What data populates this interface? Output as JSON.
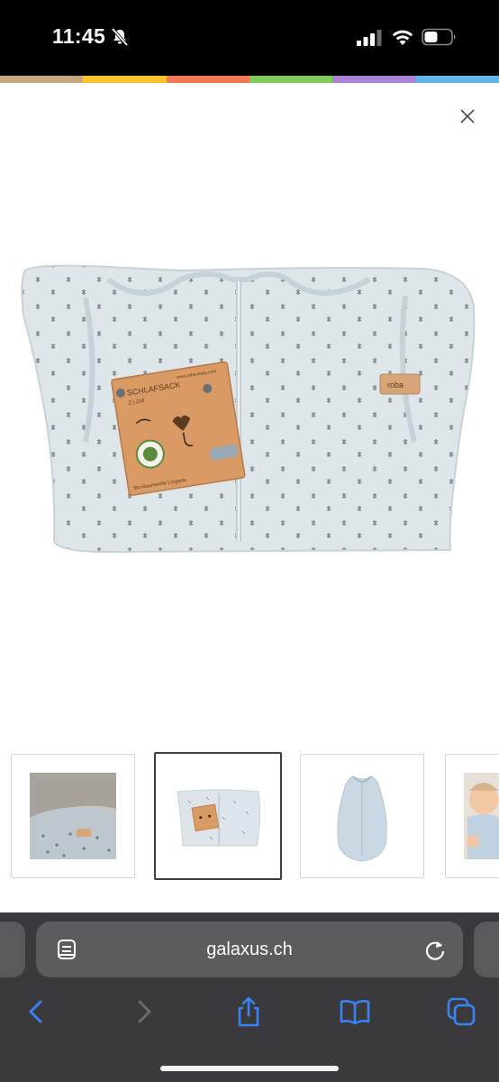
{
  "status_bar": {
    "time": "11:45",
    "icons": [
      "bell-slash-icon",
      "cellular-signal-icon",
      "wifi-icon",
      "battery-icon"
    ]
  },
  "color_strip": [
    "#c8a77f",
    "#f9c32d",
    "#f17a55",
    "#7ccd5a",
    "#a982d6",
    "#62b4ec"
  ],
  "viewer": {
    "close_icon": "close-icon",
    "product_box_text": {
      "title": "SCHLAFSACK",
      "subtitle": "2 | Zoll",
      "url": "www.roba-baby.com",
      "organic": "Bio-Baumwolle | organic",
      "brand_tag": "roba"
    }
  },
  "thumbnails": [
    {
      "name": "thumbnail-1",
      "selected": false
    },
    {
      "name": "thumbnail-2",
      "selected": true
    },
    {
      "name": "thumbnail-3",
      "selected": false
    },
    {
      "name": "thumbnail-4",
      "selected": false
    }
  ],
  "browser": {
    "address": "galaxus.ch",
    "accent": "#3b82f6",
    "icons": [
      "reader-icon",
      "reload-icon",
      "back-icon",
      "forward-icon",
      "share-icon",
      "bookmarks-icon",
      "tabs-icon"
    ]
  }
}
